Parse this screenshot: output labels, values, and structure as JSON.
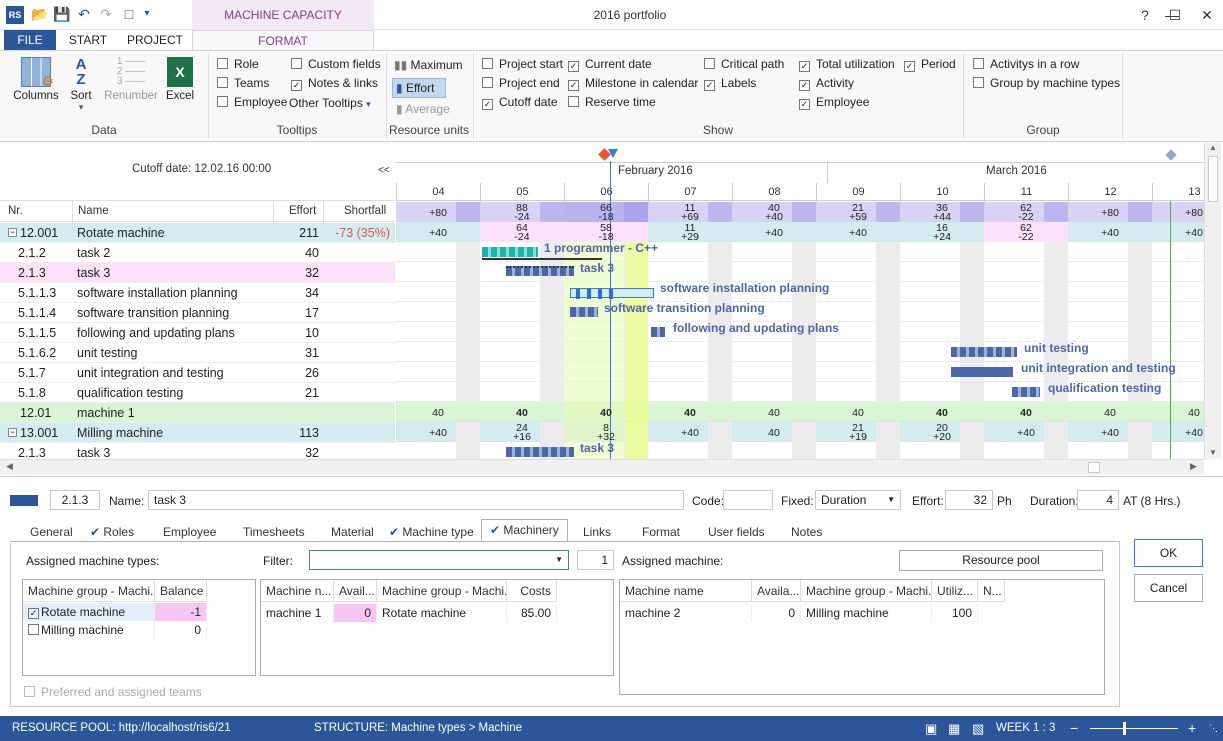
{
  "window": {
    "title": "2016 portfolio",
    "context_tab": "MACHINE CAPACITY PLANNING"
  },
  "ribbon_tabs": [
    "FILE",
    "START",
    "PROJECT",
    "FORMAT"
  ],
  "ribbon": {
    "data": {
      "label": "Data",
      "columns": "Columns",
      "sort": "Sort",
      "renumber": "Renumber",
      "excel": "Excel"
    },
    "tooltips": {
      "label": "Tooltips",
      "role": "Role",
      "teams": "Teams",
      "employee": "Employee",
      "custom_fields": "Custom fields",
      "notes_links": "Notes & links",
      "other_tooltips": "Other Tooltips"
    },
    "resource_units": {
      "label": "Resource units",
      "maximum": "Maximum",
      "effort": "Effort",
      "average": "Average"
    },
    "show": {
      "label": "Show",
      "project_start": "Project start",
      "project_end": "Project end",
      "cutoff_date": "Cutoff date",
      "current_date": "Current date",
      "milestone_in_calendar": "Milestone in calendar",
      "reserve_time": "Reserve time",
      "critical_path": "Critical path",
      "labels": "Labels",
      "total_utilization": "Total utilization",
      "activity": "Activity",
      "employee": "Employee",
      "period": "Period"
    },
    "group": {
      "label": "Group",
      "activities_in_a_row": "Activitys in a row",
      "group_by_machine_types": "Group by machine types"
    }
  },
  "grid": {
    "cutoff": "Cutoff date: 12.02.16 00:00",
    "collapse": "<<",
    "headers": {
      "nr": "Nr.",
      "name": "Name",
      "effort": "Effort",
      "shortfall": "Shortfall"
    },
    "rows": [
      {
        "nr": "12.001",
        "name": "Rotate machine",
        "effort": "211",
        "shortfall": "-73 (35%)"
      },
      {
        "nr": "2.1.2",
        "name": "task 2",
        "effort": "40",
        "shortfall": ""
      },
      {
        "nr": "2.1.3",
        "name": "task 3",
        "effort": "32",
        "shortfall": ""
      },
      {
        "nr": "5.1.1.3",
        "name": "software installation planning",
        "effort": "34",
        "shortfall": ""
      },
      {
        "nr": "5.1.1.4",
        "name": "software transition planning",
        "effort": "17",
        "shortfall": ""
      },
      {
        "nr": "5.1.1.5",
        "name": "following and updating plans",
        "effort": "10",
        "shortfall": ""
      },
      {
        "nr": "5.1.6.2",
        "name": "unit testing",
        "effort": "31",
        "shortfall": ""
      },
      {
        "nr": "5.1.7",
        "name": "unit integration and testing",
        "effort": "26",
        "shortfall": ""
      },
      {
        "nr": "5.1.8",
        "name": "qualification testing",
        "effort": "21",
        "shortfall": ""
      },
      {
        "nr": "12.01",
        "name": "machine 1",
        "effort": "",
        "shortfall": ""
      },
      {
        "nr": "13.001",
        "name": "Milling machine",
        "effort": "113",
        "shortfall": ""
      },
      {
        "nr": "2.1.3",
        "name": "task 3",
        "effort": "32",
        "shortfall": ""
      }
    ]
  },
  "gantt": {
    "months": [
      "February 2016",
      "March 2016"
    ],
    "weeks": [
      "04",
      "05",
      "06",
      "07",
      "08",
      "09",
      "10",
      "11",
      "12",
      "13"
    ],
    "util_top": [
      "+80",
      "88",
      "66",
      "11",
      "40",
      "21",
      "36",
      "62",
      "+80",
      "+80"
    ],
    "util_top2": [
      "",
      "-24",
      "-18",
      "+69",
      "+40",
      "+59",
      "+44",
      "-22",
      "",
      ""
    ],
    "util_row1a": [
      "+40",
      "64",
      "58",
      "11",
      "+40",
      "+40",
      "16",
      "62",
      "+40",
      "+40"
    ],
    "util_row1b": [
      "",
      "-24",
      "-18",
      "+29",
      "",
      "",
      "+24",
      "-22",
      "",
      ""
    ],
    "machine1": [
      "40",
      "40",
      "40",
      "40",
      "40",
      "40",
      "40",
      "40",
      "40",
      "40"
    ],
    "milling_a": [
      "+40",
      "24",
      "8",
      "+40",
      "40",
      "21",
      "20",
      "+40",
      "+40",
      "+40"
    ],
    "milling_b": [
      "",
      "+16",
      "+32",
      "",
      "",
      "+19",
      "+20",
      "",
      "",
      ""
    ],
    "labels": {
      "programmer": "1 programmer - C++",
      "task3": "task 3",
      "sip": "software installation planning",
      "stp": "software transition planning",
      "fup": "following and updating plans",
      "ut": "unit testing",
      "uit": "unit integration and testing",
      "qt": "qualification testing",
      "task3b": "task 3"
    }
  },
  "detail": {
    "nr": "2.1.3",
    "name_label": "Name:",
    "name": "task 3",
    "code_label": "Code:",
    "code": "",
    "fixed_label": "Fixed:",
    "fixed": "Duration",
    "effort_label": "Effort:",
    "effort": "32",
    "effort_unit": "Ph",
    "duration_label": "Duration:",
    "duration": "4",
    "duration_unit": "AT (8 Hrs.)",
    "tabs": [
      "General",
      "Roles",
      "Employee",
      "Timesheets",
      "Material",
      "Machine type",
      "Machinery",
      "Links",
      "Format",
      "User fields",
      "Notes"
    ],
    "assigned_types_label": "Assigned machine types:",
    "filter_label": "Filter:",
    "filter_value": "",
    "filter_count": "1",
    "assigned_machine_label": "Assigned machine:",
    "resource_pool_btn": "Resource pool",
    "ok": "OK",
    "cancel": "Cancel",
    "types_table": {
      "headers": [
        "Machine group - Machi...",
        "Balance"
      ],
      "rows": [
        {
          "name": "Rotate machine",
          "balance": "-1"
        },
        {
          "name": "Milling machine",
          "balance": "0"
        }
      ]
    },
    "machines_table": {
      "headers": [
        "Machine n...",
        "Avail...",
        "Machine group - Machi...",
        "Costs"
      ],
      "rows": [
        {
          "name": "machine 1",
          "avail": "0",
          "group": "Rotate machine",
          "costs": "85.00"
        }
      ]
    },
    "assigned_table": {
      "headers": [
        "Machine name",
        "Availa...",
        "Machine group - Machi...",
        "Utiliz...",
        "N..."
      ],
      "rows": [
        {
          "name": "machine 2",
          "avail": "0",
          "group": "Milling machine",
          "util": "100"
        }
      ]
    },
    "preferred": "Preferred and assigned teams"
  },
  "status": {
    "pool": "RESOURCE POOL: http://localhost/ris6/21",
    "structure": "STRUCTURE: Machine types > Machine",
    "week": "WEEK 1 : 3"
  }
}
